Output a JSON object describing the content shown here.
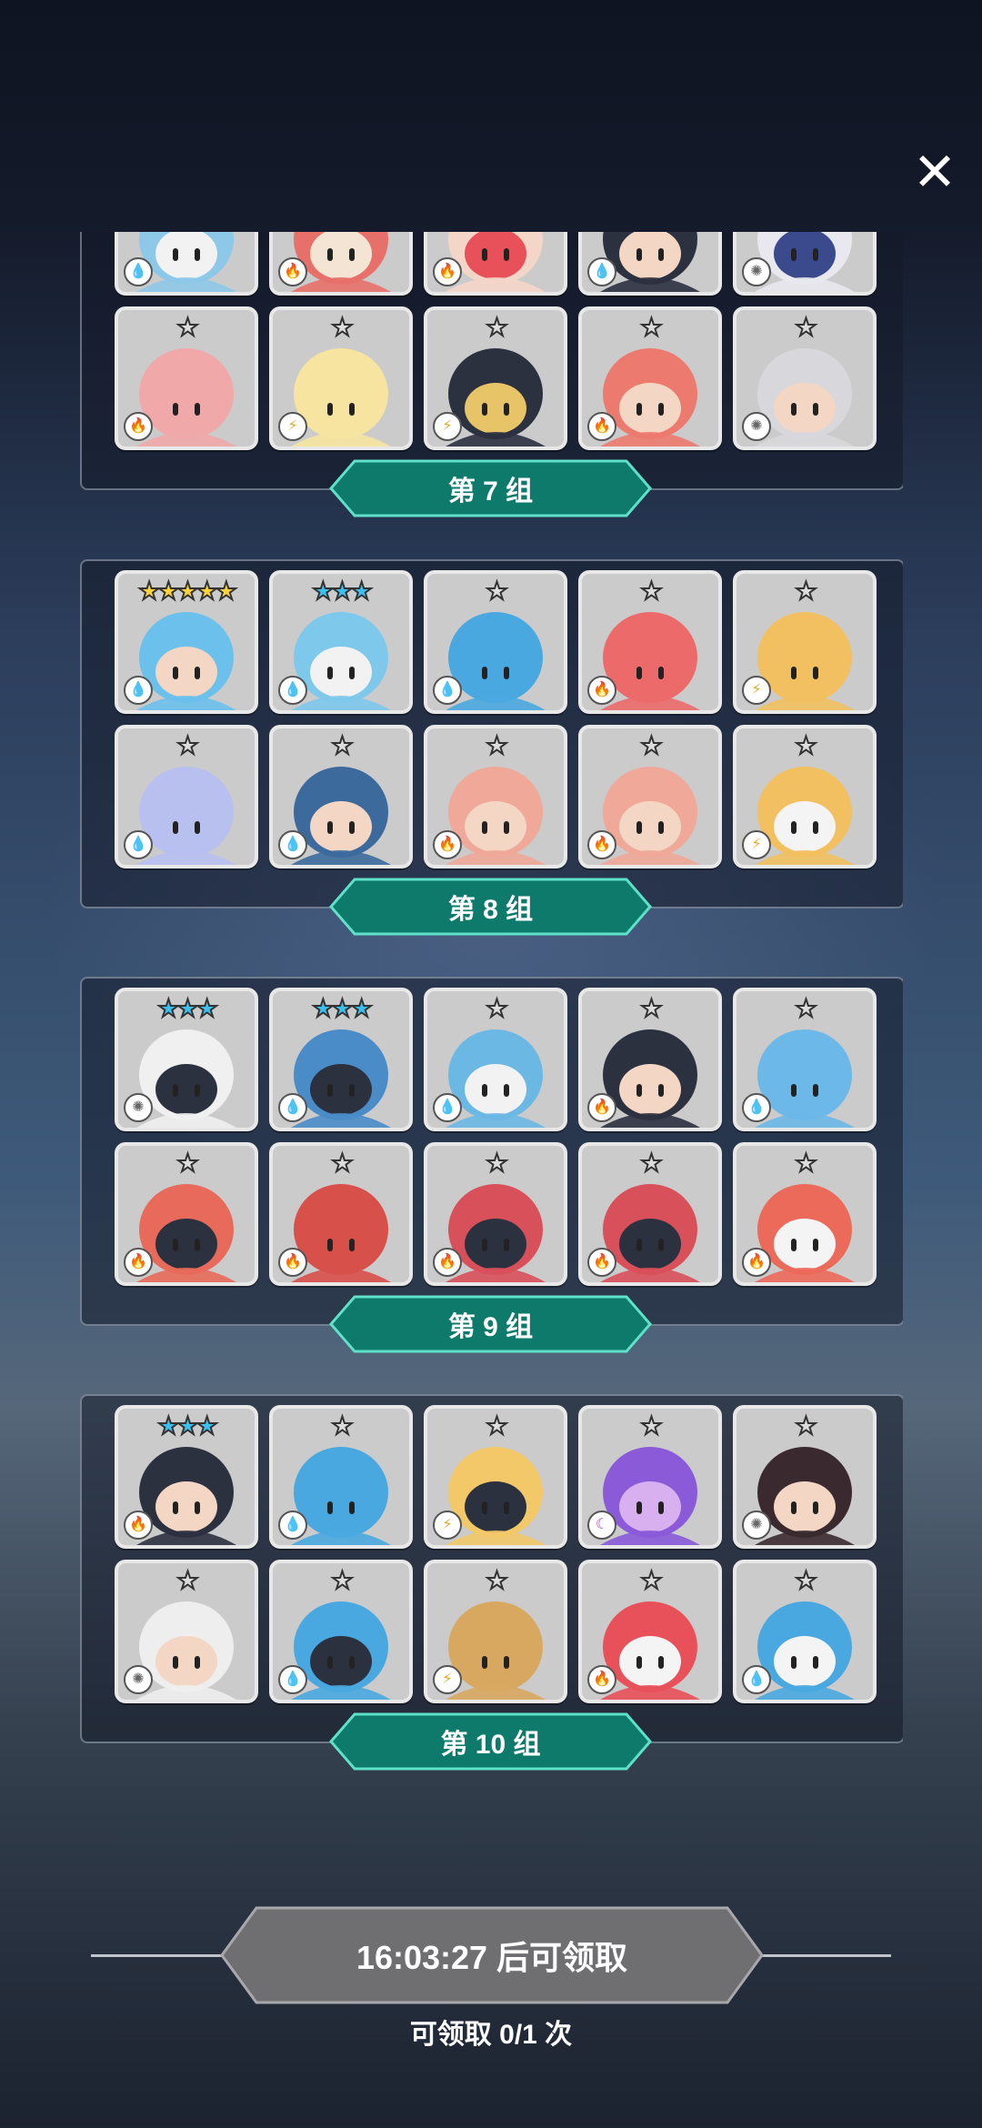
{
  "close_label": "✕",
  "groups": [
    {
      "label": "第 7 组",
      "cards": [
        {
          "stars": "★★★★★",
          "star_color": "#ffd23c",
          "element": "water",
          "body": "#8ec8e8",
          "accent": "#f2f2f2"
        },
        {
          "stars": "★★★",
          "star_color": "#3cc0f0",
          "element": "fire",
          "body": "#e8706a",
          "accent": "#f4e4d4"
        },
        {
          "stars": "★★★",
          "star_color": "#3cc0f0",
          "element": "fire",
          "body": "#f4d6c8",
          "accent": "#e8505a"
        },
        {
          "stars": "★★★",
          "star_color": "#3cc0f0",
          "element": "water",
          "body": "#2c3140",
          "accent": "#f4d6c4"
        },
        {
          "stars": "★",
          "star_color": "#dddddd",
          "element": "light",
          "body": "#e8e8ee",
          "accent": "#3a4a8c"
        },
        {
          "stars": "★",
          "star_color": "#dddddd",
          "element": "fire",
          "body": "#f0a8a8",
          "accent": "#f0a8a8"
        },
        {
          "stars": "★",
          "star_color": "#dddddd",
          "element": "thunder",
          "body": "#f6e4a0",
          "accent": "#f6e4a0"
        },
        {
          "stars": "★",
          "star_color": "#dddddd",
          "element": "thunder",
          "body": "#2c3140",
          "accent": "#e8c468"
        },
        {
          "stars": "★",
          "star_color": "#dddddd",
          "element": "fire",
          "body": "#ec7a6e",
          "accent": "#f4d6c4"
        },
        {
          "stars": "★",
          "star_color": "#dddddd",
          "element": "light",
          "body": "#d8d8dc",
          "accent": "#f4d6c4"
        }
      ]
    },
    {
      "label": "第 8 组",
      "cards": [
        {
          "stars": "★★★★★",
          "star_color": "#ffd23c",
          "element": "water",
          "body": "#6cc0ec",
          "accent": "#f4d6c4"
        },
        {
          "stars": "★★★",
          "star_color": "#3cc0f0",
          "element": "water",
          "body": "#7ec8ec",
          "accent": "#f2f2f2"
        },
        {
          "stars": "★",
          "star_color": "#dddddd",
          "element": "water",
          "body": "#4aa8e0",
          "accent": "#4aa8e0"
        },
        {
          "stars": "★",
          "star_color": "#dddddd",
          "element": "fire",
          "body": "#ec6a6a",
          "accent": "#ec6a6a"
        },
        {
          "stars": "★",
          "star_color": "#dddddd",
          "element": "thunder",
          "body": "#f2c060",
          "accent": "#f2c060"
        },
        {
          "stars": "★",
          "star_color": "#dddddd",
          "element": "water",
          "body": "#b8c0f0",
          "accent": "#b8c0f0"
        },
        {
          "stars": "★",
          "star_color": "#dddddd",
          "element": "water",
          "body": "#3c6a9c",
          "accent": "#f4d6c4"
        },
        {
          "stars": "★",
          "star_color": "#dddddd",
          "element": "fire",
          "body": "#f0a898",
          "accent": "#f4d6c4"
        },
        {
          "stars": "★",
          "star_color": "#dddddd",
          "element": "fire",
          "body": "#f0a898",
          "accent": "#f4d6c4"
        },
        {
          "stars": "★",
          "star_color": "#dddddd",
          "element": "thunder",
          "body": "#f2c060",
          "accent": "#f4f4f4"
        }
      ]
    },
    {
      "label": "第 9 组",
      "cards": [
        {
          "stars": "★★★",
          "star_color": "#3cc0f0",
          "element": "light",
          "body": "#f0f0f0",
          "accent": "#2c3140"
        },
        {
          "stars": "★★★",
          "star_color": "#3cc0f0",
          "element": "water",
          "body": "#4a8cc8",
          "accent": "#2c3140"
        },
        {
          "stars": "★",
          "star_color": "#dddddd",
          "element": "water",
          "body": "#6cb8e4",
          "accent": "#f2f2f2"
        },
        {
          "stars": "★",
          "star_color": "#dddddd",
          "element": "fire",
          "body": "#2c3140",
          "accent": "#f4d6c4"
        },
        {
          "stars": "★",
          "star_color": "#dddddd",
          "element": "water",
          "body": "#6cb8e8",
          "accent": "#6cb8e8"
        },
        {
          "stars": "★",
          "star_color": "#dddddd",
          "element": "fire",
          "body": "#e86a5a",
          "accent": "#2c3140"
        },
        {
          "stars": "★",
          "star_color": "#dddddd",
          "element": "fire",
          "body": "#d8504a",
          "accent": "#d8504a"
        },
        {
          "stars": "★",
          "star_color": "#dddddd",
          "element": "fire",
          "body": "#d8505a",
          "accent": "#2c3140"
        },
        {
          "stars": "★",
          "star_color": "#dddddd",
          "element": "fire",
          "body": "#d8505a",
          "accent": "#2c3140"
        },
        {
          "stars": "★",
          "star_color": "#dddddd",
          "element": "fire",
          "body": "#ec6a5a",
          "accent": "#f4f4f4"
        }
      ]
    },
    {
      "label": "第 10 组",
      "cards": [
        {
          "stars": "★★★",
          "star_color": "#3cc0f0",
          "element": "fire",
          "body": "#2c3140",
          "accent": "#f4d6c4"
        },
        {
          "stars": "★",
          "star_color": "#dddddd",
          "element": "water",
          "body": "#4aa8e0",
          "accent": "#4aa8e0"
        },
        {
          "stars": "★",
          "star_color": "#dddddd",
          "element": "thunder",
          "body": "#f2c868",
          "accent": "#2c3140"
        },
        {
          "stars": "★",
          "star_color": "#dddddd",
          "element": "dark",
          "body": "#8a5ad8",
          "accent": "#d8b0f0"
        },
        {
          "stars": "★",
          "star_color": "#dddddd",
          "element": "light",
          "body": "#3a2a30",
          "accent": "#f4d6c4"
        },
        {
          "stars": "★",
          "star_color": "#dddddd",
          "element": "light",
          "body": "#eeeeee",
          "accent": "#f4d6c4"
        },
        {
          "stars": "★",
          "star_color": "#dddddd",
          "element": "water",
          "body": "#4aa8e0",
          "accent": "#2c3140"
        },
        {
          "stars": "★",
          "star_color": "#dddddd",
          "element": "thunder",
          "body": "#d8a860",
          "accent": "#d8a860"
        },
        {
          "stars": "★",
          "star_color": "#dddddd",
          "element": "fire",
          "body": "#e8505a",
          "accent": "#f4f4f4"
        },
        {
          "stars": "★",
          "star_color": "#dddddd",
          "element": "water",
          "body": "#4aa8e0",
          "accent": "#f4f4f4"
        }
      ]
    }
  ],
  "element_glyphs": {
    "water": {
      "glyph": "💧",
      "color": "#2d8fe0"
    },
    "fire": {
      "glyph": "🔥",
      "color": "#e84a2a"
    },
    "thunder": {
      "glyph": "⚡",
      "color": "#e8a820"
    },
    "light": {
      "glyph": "✺",
      "color": "#666666"
    },
    "dark": {
      "glyph": "☾",
      "color": "#b040c0"
    }
  },
  "colors": {
    "banner_fill": "#0e7a6c",
    "banner_border": "#5fe0c8",
    "claim_fill": "#6f6f72",
    "claim_border": "#a8a8ac"
  },
  "claim": {
    "button_label": "16:03:27 后可领取",
    "count_label": "可领取 0/1 次"
  }
}
